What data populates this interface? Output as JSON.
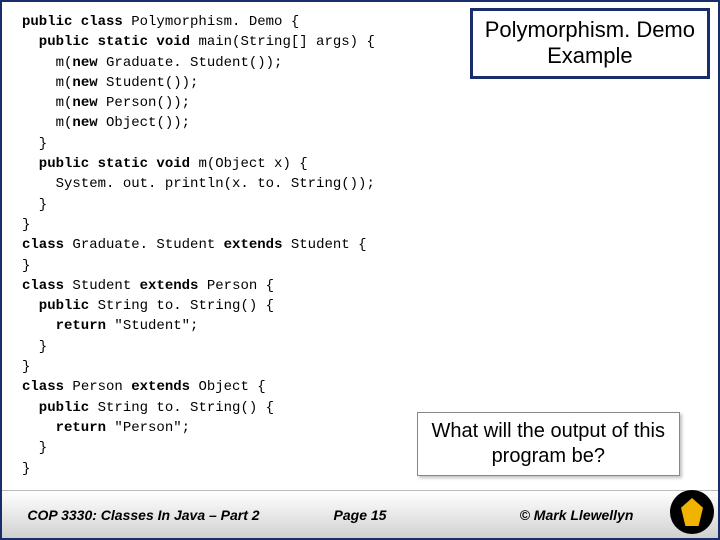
{
  "title": {
    "line1": "Polymorphism. Demo",
    "line2": "Example"
  },
  "code": {
    "l1a": "public class ",
    "l1b": "Polymorphism. Demo {",
    "l2a": "  public static void ",
    "l2b": "main(String[] args) {",
    "l3a": "    m(",
    "l3b": "new ",
    "l3c": "Graduate. Student());",
    "l4a": "    m(",
    "l4b": "new ",
    "l4c": "Student());",
    "l5a": "    m(",
    "l5b": "new ",
    "l5c": "Person());",
    "l6a": "    m(",
    "l6b": "new ",
    "l6c": "Object());",
    "l7": "  }",
    "l8a": "  public static void ",
    "l8b": "m(Object x) {",
    "l9": "    System. out. println(x. to. String());",
    "l10": "  }",
    "l11": "}",
    "l12a": "class ",
    "l12b": "Graduate. Student ",
    "l12c": "extends ",
    "l12d": "Student {",
    "l13": "}",
    "l14a": "class ",
    "l14b": "Student ",
    "l14c": "extends ",
    "l14d": "Person {",
    "l15a": "  public ",
    "l15b": "String to. String() {",
    "l16a": "    return ",
    "l16b": "\"Student\";",
    "l17": "  }",
    "l18": "}",
    "l19a": "class ",
    "l19b": "Person ",
    "l19c": "extends ",
    "l19d": "Object {",
    "l20a": "  public ",
    "l20b": "String to. String() {",
    "l21a": "    return ",
    "l21b": "\"Person\";",
    "l22": "  }",
    "l23": "}"
  },
  "question": {
    "line1": "What will the output of this",
    "line2": "program be?"
  },
  "footer": {
    "left": "COP 3330: Classes In Java – Part 2",
    "center": "Page 15",
    "right": "© Mark Llewellyn"
  }
}
